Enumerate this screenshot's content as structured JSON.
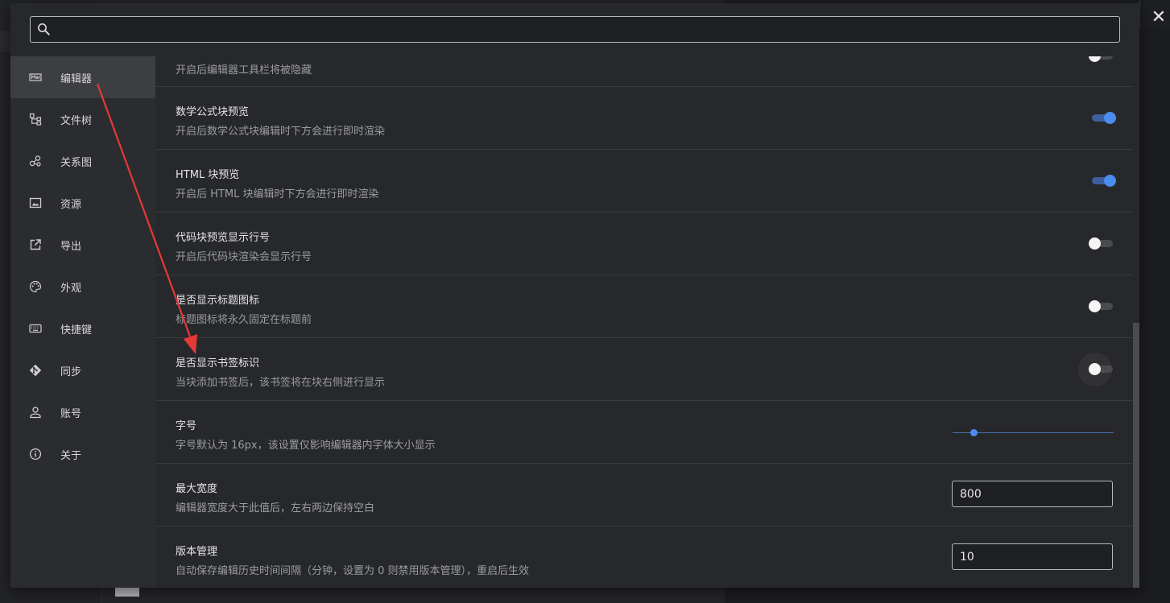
{
  "search": {
    "value": "",
    "placeholder": ""
  },
  "sidebar": {
    "items": [
      {
        "label": "编辑器",
        "icon": "markdown-icon",
        "active": true
      },
      {
        "label": "文件树",
        "icon": "file-tree-icon",
        "active": false
      },
      {
        "label": "关系图",
        "icon": "graph-icon",
        "active": false
      },
      {
        "label": "资源",
        "icon": "image-icon",
        "active": false
      },
      {
        "label": "导出",
        "icon": "export-icon",
        "active": false
      },
      {
        "label": "外观",
        "icon": "palette-icon",
        "active": false
      },
      {
        "label": "快捷键",
        "icon": "keyboard-icon",
        "active": false
      },
      {
        "label": "同步",
        "icon": "git-sync-icon",
        "active": false
      },
      {
        "label": "账号",
        "icon": "account-icon",
        "active": false
      },
      {
        "label": "关于",
        "icon": "info-icon",
        "active": false
      }
    ]
  },
  "settings": {
    "hide_toolbar": {
      "desc": "开启后编辑器工具栏将被隐藏",
      "on": false
    },
    "math_preview": {
      "title": "数学公式块预览",
      "desc": "开启后数学公式块编辑时下方会进行即时渲染",
      "on": true
    },
    "html_preview": {
      "title": "HTML 块预览",
      "desc": "开启后 HTML 块编辑时下方会进行即时渲染",
      "on": true
    },
    "code_line_numbers": {
      "title": "代码块预览显示行号",
      "desc": "开启后代码块渲染会显示行号",
      "on": false
    },
    "heading_icon": {
      "title": "是否显示标题图标",
      "desc": "标题图标将永久固定在标题前",
      "on": false
    },
    "bookmark_flag": {
      "title": "是否显示书签标识",
      "desc": "当块添加书签后，该书签将在块右侧进行显示",
      "on": false
    },
    "font_size": {
      "title": "字号",
      "desc": "字号默认为 16px，该设置仅影响编辑器内字体大小显示",
      "value_fraction": 0.13
    },
    "max_width": {
      "title": "最大宽度",
      "desc": "编辑器宽度大于此值后，左右两边保持空白",
      "value": "800"
    },
    "history": {
      "title": "版本管理",
      "desc": "自动保存编辑历史时间间隔（分钟，设置为 0 则禁用版本管理），重启后生效",
      "value": "10"
    }
  },
  "colors": {
    "accent": "#4a8cf0",
    "annotation_arrow": "#e53935",
    "dialog_bg": "#27282b",
    "sidebar_bg": "#2b2c30"
  }
}
